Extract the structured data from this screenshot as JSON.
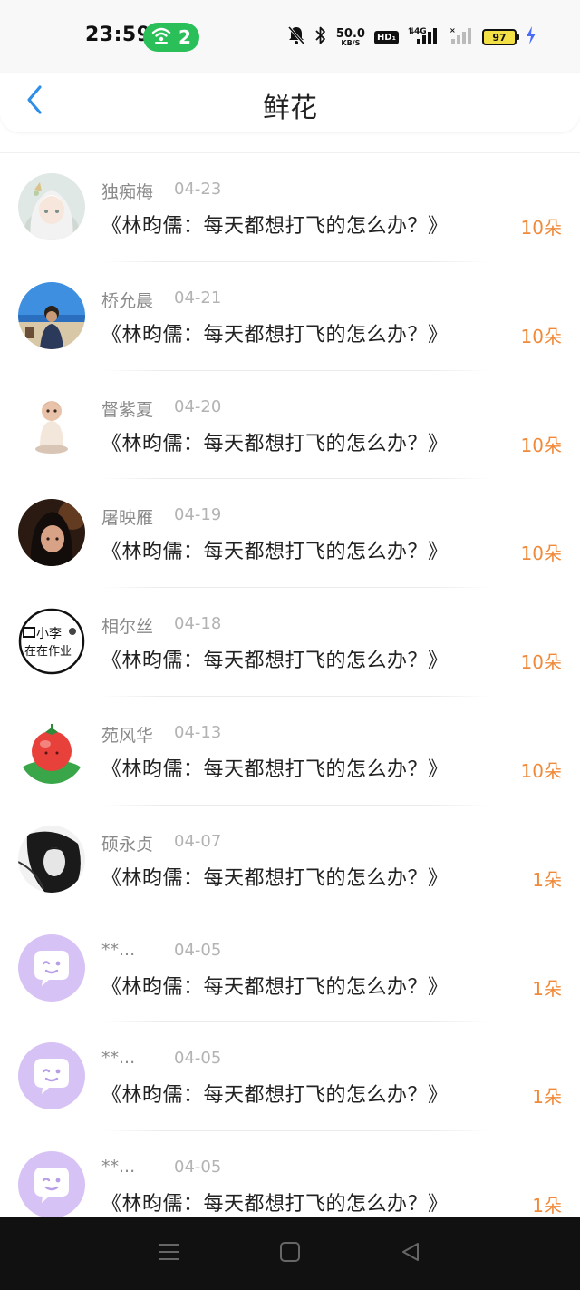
{
  "status_bar": {
    "time": "23:59",
    "hotspot_count": "2",
    "speed_value": "50.0",
    "speed_unit": "KB/S",
    "hd_label": "HD₁",
    "network_label": "4G",
    "battery_level": "97"
  },
  "header": {
    "title": "鲜花"
  },
  "colors": {
    "accent_blue": "#2e8fe8",
    "flower_orange": "#f08a3a",
    "hotspot_green": "#2bbf5a",
    "default_avatar_purple": "#d7c2f5"
  },
  "list": [
    {
      "name": "独痴梅",
      "date": "04-23",
      "article": "《林昀儒：每天都想打飞的怎么办？》",
      "flowers": "10朵",
      "avatar": "anime-girl"
    },
    {
      "name": "桥允晨",
      "date": "04-21",
      "article": "《林昀儒：每天都想打飞的怎么办？》",
      "flowers": "10朵",
      "avatar": "beach-person"
    },
    {
      "name": "督紫夏",
      "date": "04-20",
      "article": "《林昀儒：每天都想打飞的怎么办？》",
      "flowers": "10朵",
      "avatar": "baby"
    },
    {
      "name": "屠映雁",
      "date": "04-19",
      "article": "《林昀儒：每天都想打飞的怎么办？》",
      "flowers": "10朵",
      "avatar": "dark-portrait"
    },
    {
      "name": "相尔丝",
      "date": "04-18",
      "article": "《林昀儒：每天都想打飞的怎么办？》",
      "flowers": "10朵",
      "avatar": "homework-logo",
      "avatar_text_top": "小李",
      "avatar_text_bottom": "在在作业"
    },
    {
      "name": "苑风华",
      "date": "04-13",
      "article": "《林昀儒：每天都想打飞的怎么办？》",
      "flowers": "10朵",
      "avatar": "tomato"
    },
    {
      "name": "硕永贞",
      "date": "04-07",
      "article": "《林昀儒：每天都想打飞的怎么办？》",
      "flowers": "1朵",
      "avatar": "bw-portrait"
    },
    {
      "name": "**...",
      "date": "04-05",
      "article": "《林昀儒：每天都想打飞的怎么办？》",
      "flowers": "1朵",
      "avatar": "default-chat"
    },
    {
      "name": "**...",
      "date": "04-05",
      "article": "《林昀儒：每天都想打飞的怎么办？》",
      "flowers": "1朵",
      "avatar": "default-chat"
    },
    {
      "name": "**...",
      "date": "04-05",
      "article": "《林昀儒：每天都想打飞的怎么办？》",
      "flowers": "1朵",
      "avatar": "default-chat"
    }
  ]
}
